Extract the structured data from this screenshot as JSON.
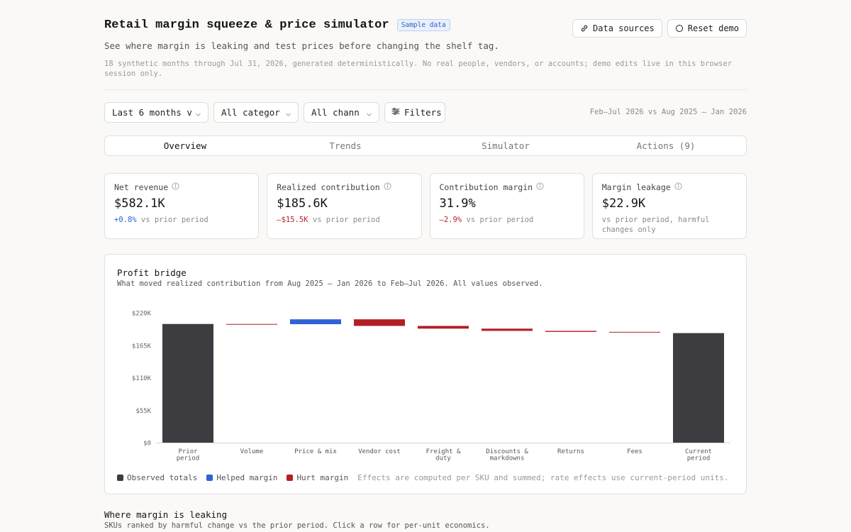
{
  "header": {
    "title": "Retail margin squeeze & price simulator",
    "badge": "Sample data",
    "subtitle": "See where margin is leaking and test prices before changing the shelf tag.",
    "note": "18 synthetic months through Jul 31, 2026, generated deterministically. No real people, vendors, or accounts; demo edits live in this browser session only.",
    "data_sources_label": "Data sources",
    "reset_label": "Reset demo"
  },
  "filters": {
    "period": "Last 6 months v",
    "category": "All categor",
    "channel": "All channe",
    "filters_label": "Filters",
    "comparison": "Feb–Jul 2026 vs Aug 2025 – Jan 2026"
  },
  "tabs": [
    {
      "label": "Overview",
      "active": true
    },
    {
      "label": "Trends",
      "active": false
    },
    {
      "label": "Simulator",
      "active": false
    },
    {
      "label": "Actions (9)",
      "active": false
    }
  ],
  "kpis": [
    {
      "label": "Net revenue",
      "value": "$582.1K",
      "delta": "+0.8%",
      "delta_dir": "up",
      "suffix": " vs prior period"
    },
    {
      "label": "Realized contribution",
      "value": "$185.6K",
      "delta": "–$15.5K",
      "delta_dir": "down",
      "suffix": " vs prior period"
    },
    {
      "label": "Contribution margin",
      "value": "31.9%",
      "delta": "–2.9%",
      "delta_dir": "down",
      "suffix": " vs prior period"
    },
    {
      "label": "Margin leakage",
      "value": "$22.9K",
      "delta": "",
      "delta_dir": "",
      "suffix": "vs prior period, harmful changes only"
    }
  ],
  "bridge": {
    "title": "Profit bridge",
    "subtitle": "What moved realized contribution from Aug 2025 – Jan 2026 to Feb–Jul 2026. All values observed.",
    "legend": [
      {
        "label": "Observed totals",
        "color": "#3d3c40"
      },
      {
        "label": "Helped margin",
        "color": "#2f62d4"
      },
      {
        "label": "Hurt margin",
        "color": "#b41e25"
      }
    ],
    "legend_note": "Effects are computed per SKU and summed; rate effects use current-period units."
  },
  "chart_data": {
    "type": "bar",
    "subtype": "waterfall",
    "categories": [
      "Prior period",
      "Volume",
      "Price & mix",
      "Vendor cost",
      "Freight & duty",
      "Discounts & markdowns",
      "Returns",
      "Fees",
      "Current period"
    ],
    "category_lines": [
      [
        "Prior",
        "period"
      ],
      [
        "Volume"
      ],
      [
        "Price & mix"
      ],
      [
        "Vendor cost"
      ],
      [
        "Freight &",
        "duty"
      ],
      [
        "Discounts &",
        "markdowns"
      ],
      [
        "Returns"
      ],
      [
        "Fees"
      ],
      [
        "Current",
        "period"
      ]
    ],
    "values": [
      201100,
      -400,
      8300,
      -11200,
      -4600,
      -3800,
      -1700,
      -1100,
      185600
    ],
    "kinds": [
      "total",
      "hurt",
      "helped",
      "hurt",
      "hurt",
      "hurt",
      "hurt",
      "hurt",
      "total"
    ],
    "yticks": [
      0,
      55000,
      110000,
      165000,
      220000
    ],
    "ytick_labels": [
      "$0",
      "$55K",
      "$110K",
      "$165K",
      "$220K"
    ],
    "ylim": [
      0,
      220000
    ],
    "colors": {
      "total": "#3d3c40",
      "helped": "#2f62d4",
      "hurt": "#b41e25"
    }
  },
  "leaking": {
    "title": "Where margin is leaking",
    "subtitle": "SKUs ranked by harmful change vs the prior period. Click a row for per-unit economics."
  }
}
